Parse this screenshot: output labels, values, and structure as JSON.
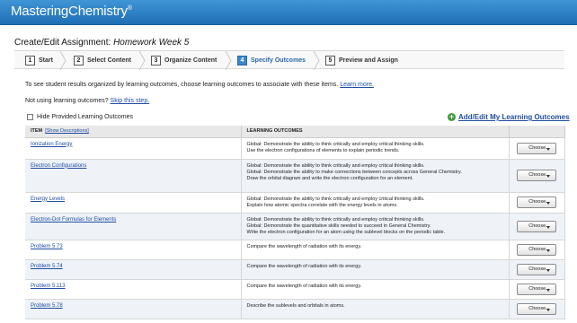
{
  "brand": {
    "name": "MasteringChemistry",
    "mark": "®"
  },
  "page": {
    "title_prefix": "Create/Edit Assignment:",
    "title_name": "Homework Week 5"
  },
  "steps": [
    {
      "num": "1",
      "label": "Start"
    },
    {
      "num": "2",
      "label": "Select Content"
    },
    {
      "num": "3",
      "label": "Organize Content"
    },
    {
      "num": "4",
      "label": "Specify Outcomes",
      "active": true
    },
    {
      "num": "5",
      "label": "Preview and Assign"
    }
  ],
  "info": {
    "line1": "To see student results organized by learning outcomes, choose learning outcomes to associate with these items.",
    "learn_more": "Learn more.",
    "line2": "Not using learning outcomes?",
    "skip": "Skip this step."
  },
  "hide_label": "Hide Provided Learning Outcomes",
  "add_edit_label": "Add/Edit My Learning Outcomes",
  "table": {
    "col_item": "ITEM",
    "show_desc": "[Show Descriptions]",
    "col_outcomes": "LEARNING OUTCOMES",
    "choose_label": "Choose...",
    "rows": [
      {
        "item": "Ionization Energy",
        "outcomes": [
          "Global: Demonstrate the ability to think critically and employ critical thinking skills.",
          "Use the electron configurations of elements to explain periodic trends."
        ]
      },
      {
        "item": "Electron Configurations",
        "outcomes": [
          "Global: Demonstrate the ability to think critically and employ critical thinking skills.",
          "Global: Demonstrate the ability to make connections between concepts across General Chemistry.",
          "Draw the orbital diagram and write the electron configuration for an element."
        ]
      },
      {
        "item": "Energy Levels",
        "outcomes": [
          "Global: Demonstrate the ability to think critically and employ critical thinking skills.",
          "Explain how atomic spectra correlate with the energy levels in atoms."
        ]
      },
      {
        "item": "Electron-Dot Formulas for Elements",
        "outcomes": [
          "Global: Demonstrate the ability to think critically and employ critical thinking skills.",
          "Global: Demonstrate the quantitative skills needed to succeed in General Chemistry.",
          "Write the electron configuration for an atom using the sublevel blocks on the periodic table."
        ]
      },
      {
        "item": "Problem 5.73",
        "outcomes": [
          "Compare the wavelength of radiation with its energy."
        ]
      },
      {
        "item": "Problem 5.74",
        "outcomes": [
          "Compare the wavelength of radiation with its energy."
        ]
      },
      {
        "item": "Problem 5.113",
        "outcomes": [
          "Compare the wavelength of radiation with its energy."
        ]
      },
      {
        "item": "Problem 5.78",
        "outcomes": [
          "Describe the sublevels and orbitals in atoms."
        ]
      }
    ]
  }
}
